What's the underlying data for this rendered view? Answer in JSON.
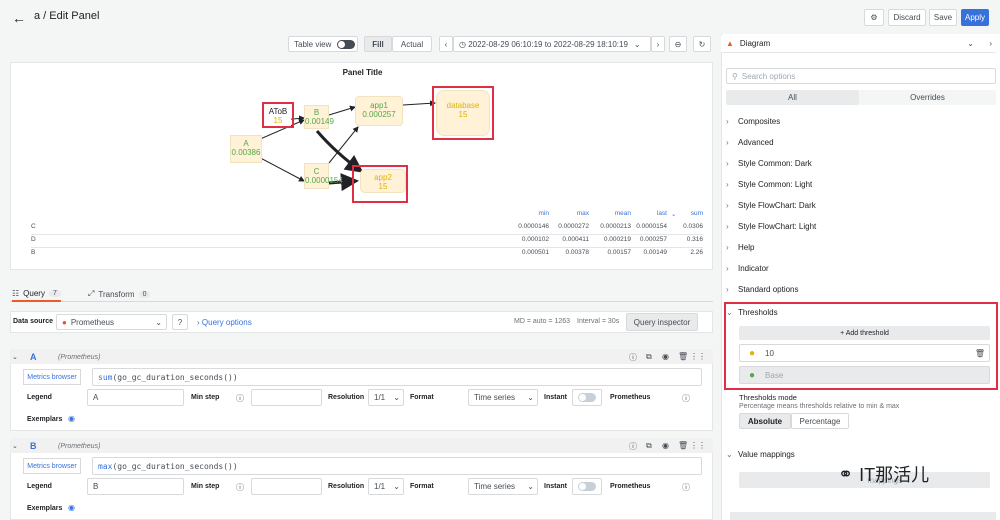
{
  "header": {
    "title": "a / Edit Panel",
    "discard_label": "Discard",
    "save_label": "Save",
    "apply_label": "Apply"
  },
  "toolbar": {
    "table_view_label": "Table view",
    "fill_label": "Fill",
    "actual_label": "Actual",
    "time_range": "2022-08-29 06:10:19 to 2022-08-29 18:10:19"
  },
  "panel": {
    "title": "Panel Title",
    "nodes": {
      "atob": {
        "label": "AToB",
        "value": "15"
      },
      "a": {
        "label": "A",
        "value": "0.00386"
      },
      "b": {
        "label": "B",
        "value": "0.00149"
      },
      "c": {
        "label": "C",
        "value": "0.0000154"
      },
      "app1": {
        "label": "app1",
        "value": "0.000257"
      },
      "app2": {
        "label": "app2",
        "value": "15"
      },
      "database": {
        "label": "database",
        "value": "15"
      }
    },
    "legend_headers": [
      "min",
      "max",
      "mean",
      "last",
      "sum"
    ],
    "legend_rows": [
      {
        "name": "C",
        "values": [
          "0.0000146",
          "0.0000272",
          "0.0000213",
          "0.0000154",
          "0.0306"
        ]
      },
      {
        "name": "D",
        "values": [
          "0.000102",
          "0.000411",
          "0.000219",
          "0.000257",
          "0.316"
        ]
      },
      {
        "name": "B",
        "values": [
          "0.000501",
          "0.00378",
          "0.00157",
          "0.00149",
          "2.26"
        ]
      }
    ]
  },
  "tabs": {
    "query_label": "Query",
    "query_count": "7",
    "transform_label": "Transform",
    "transform_count": "0"
  },
  "datasource": {
    "label": "Data source",
    "value": "Prometheus",
    "query_options": "Query options",
    "md_info": "MD = auto = 1263",
    "interval_info": "Interval = 30s",
    "inspector_label": "Query inspector"
  },
  "queries": [
    {
      "ref": "A",
      "source": "(Prometheus)",
      "metrics_label": "Metrics browser",
      "expr_fn": "sum",
      "expr_rest": "(go_gc_duration_seconds())",
      "legend": "A",
      "resolution": "1/1",
      "format": "Time series"
    },
    {
      "ref": "B",
      "source": "(Prometheus)",
      "metrics_label": "Metrics browser",
      "expr_fn": "max",
      "expr_rest": "(go_gc_duration_seconds())",
      "legend": "B",
      "resolution": "1/1",
      "format": "Time series"
    }
  ],
  "query_labels": {
    "legend": "Legend",
    "min_step": "Min step",
    "resolution": "Resolution",
    "format": "Format",
    "instant": "Instant",
    "prometheus": "Prometheus",
    "exemplars": "Exemplars"
  },
  "options": {
    "visualization": "Diagram",
    "search_placeholder": "Search options",
    "all_label": "All",
    "overrides_label": "Overrides",
    "sections": [
      "Composites",
      "Advanced",
      "Style Common: Dark",
      "Style Common: Light",
      "Style FlowChart: Dark",
      "Style FlowChart: Light",
      "Help",
      "Indicator",
      "Standard options"
    ],
    "thresholds_title": "Thresholds",
    "add_threshold": "+ Add threshold",
    "threshold_value": "10",
    "threshold_base": "Base",
    "mode_title": "Thresholds mode",
    "mode_desc": "Percentage means thresholds relative to min & max",
    "absolute_label": "Absolute",
    "percentage_label": "Percentage",
    "value_mappings": "Value mappings",
    "mappings_button": "mappings"
  },
  "watermark": "IT那活儿",
  "colors": {
    "accent": "#3871dc",
    "highlight": "#e02f44",
    "green": "#56a64b",
    "yellow": "#e0b400"
  }
}
